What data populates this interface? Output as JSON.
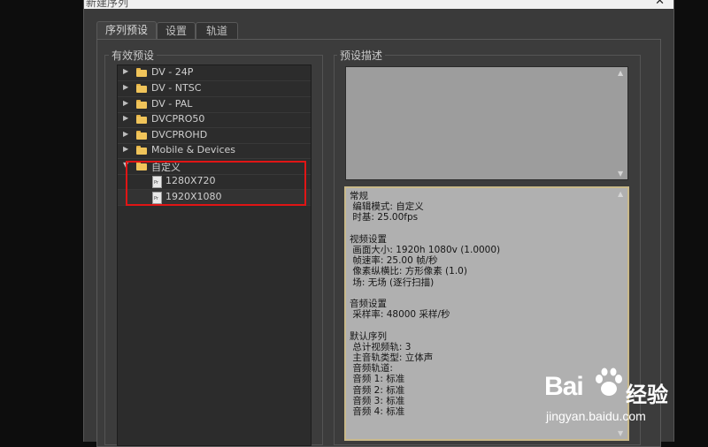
{
  "window": {
    "title": "新建序列",
    "close_glyph": "✕"
  },
  "tabs": [
    {
      "label": "序列预设",
      "active": true
    },
    {
      "label": "设置",
      "active": false
    },
    {
      "label": "轨道",
      "active": false
    }
  ],
  "presets_group": {
    "label": "有效预设",
    "items": [
      {
        "label": "DV - 24P",
        "expanded": false,
        "icon": "folder-icon"
      },
      {
        "label": "DV - NTSC",
        "expanded": false,
        "icon": "folder-icon"
      },
      {
        "label": "DV - PAL",
        "expanded": false,
        "icon": "folder-icon"
      },
      {
        "label": "DVCPRO50",
        "expanded": false,
        "icon": "folder-icon"
      },
      {
        "label": "DVCPROHD",
        "expanded": false,
        "icon": "folder-icon"
      },
      {
        "label": "Mobile & Devices",
        "expanded": false,
        "icon": "folder-icon"
      },
      {
        "label": "自定义",
        "expanded": true,
        "icon": "folder-icon"
      }
    ],
    "children": [
      {
        "label": "1280X720",
        "icon": "preset-file-icon"
      },
      {
        "label": "1920X1080",
        "icon": "preset-file-icon"
      }
    ]
  },
  "description_group": {
    "label": "预设描述",
    "lines": [
      "常规",
      " 编辑模式: 自定义",
      " 时基: 25.00fps",
      "",
      "视频设置",
      " 画面大小: 1920h 1080v (1.0000)",
      " 帧速率: 25.00 帧/秒",
      " 像素纵横比: 方形像素 (1.0)",
      " 场: 无场 (逐行扫描)",
      "",
      "音频设置",
      " 采样率: 48000 采样/秒",
      "",
      "默认序列",
      " 总计视频轨: 3",
      " 主音轨类型: 立体声",
      " 音频轨道:",
      " 音频 1: 标准",
      " 音频 2: 标准",
      " 音频 3: 标准",
      " 音频 4: 标准"
    ]
  },
  "scroll": {
    "up": "▲",
    "down": "▼"
  },
  "watermark": {
    "brand": "Bai",
    "cn": "经验",
    "url": "jingyan.baidu.com"
  },
  "colors": {
    "highlight_box": "#e01515",
    "folder": "#f0c45a",
    "dialog_bg": "#3a3a3a"
  }
}
